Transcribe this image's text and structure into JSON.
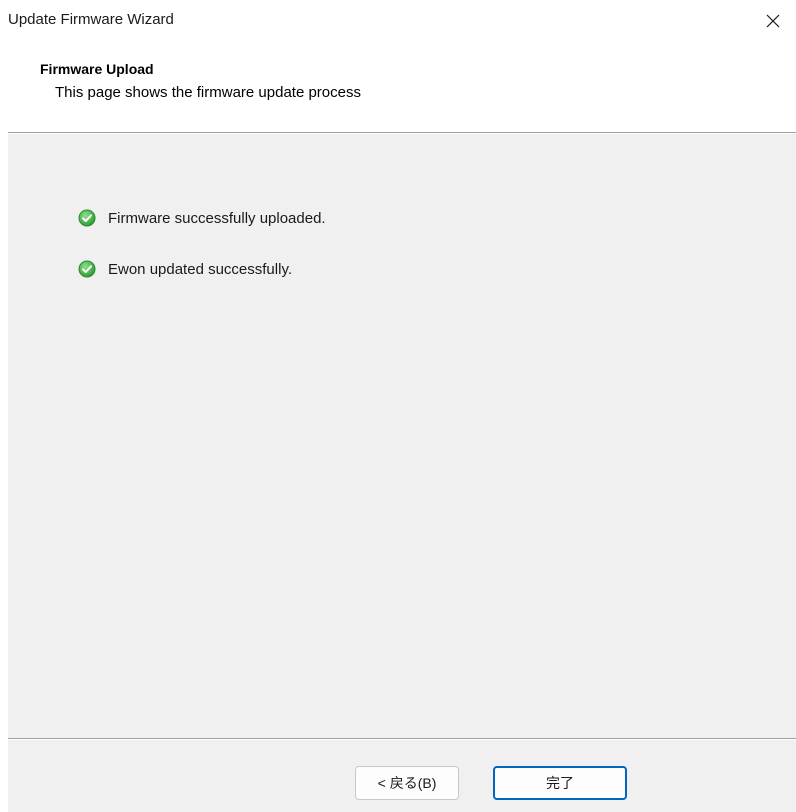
{
  "window": {
    "title": "Update Firmware Wizard",
    "close_icon": "close-icon"
  },
  "header": {
    "title": "Firmware Upload",
    "subtitle": "This page shows the firmware update process"
  },
  "status": {
    "items": [
      {
        "icon": "check-circle-icon",
        "text": "Firmware successfully uploaded."
      },
      {
        "icon": "check-circle-icon",
        "text": "Ewon updated successfully."
      }
    ]
  },
  "footer": {
    "back_label": "< 戻る(B)",
    "finish_label": "完了"
  },
  "colors": {
    "content_bg": "#f0f0f0",
    "accent": "#0067c0",
    "success": "#3cb043"
  }
}
